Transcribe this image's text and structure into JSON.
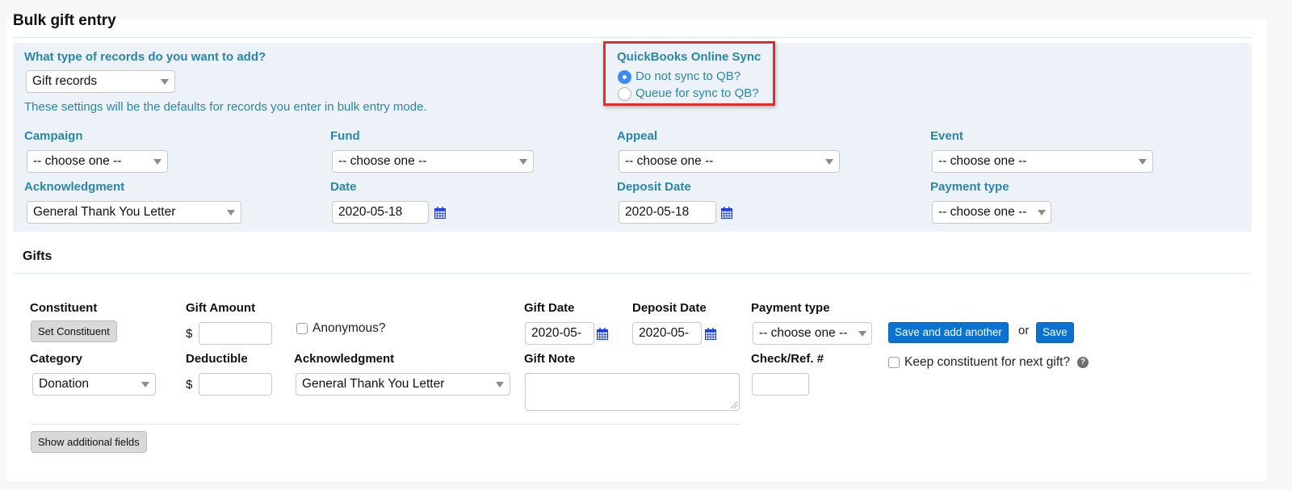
{
  "page": {
    "title": "Bulk gift entry"
  },
  "defaults": {
    "record_type": {
      "label": "What type of records do you want to add?",
      "value": "Gift records"
    },
    "help_text": "These settings will be the defaults for records you enter in bulk entry mode.",
    "quickbooks": {
      "label": "QuickBooks Online Sync",
      "options": [
        {
          "label": "Do not sync to QB?",
          "checked": true
        },
        {
          "label": "Queue for sync to QB?",
          "checked": false
        }
      ]
    },
    "campaign": {
      "label": "Campaign",
      "value": "-- choose one --"
    },
    "fund": {
      "label": "Fund",
      "value": "-- choose one --"
    },
    "appeal": {
      "label": "Appeal",
      "value": "-- choose one --"
    },
    "event": {
      "label": "Event",
      "value": "-- choose one --"
    },
    "acknowledgment": {
      "label": "Acknowledgment",
      "value": "General Thank You Letter"
    },
    "date": {
      "label": "Date",
      "value": "2020-05-18"
    },
    "deposit_date": {
      "label": "Deposit Date",
      "value": "2020-05-18"
    },
    "payment_type": {
      "label": "Payment type",
      "value": "-- choose one --"
    }
  },
  "gifts": {
    "title": "Gifts",
    "constituent": {
      "label": "Constituent",
      "button": "Set Constituent"
    },
    "gift_amount": {
      "label": "Gift Amount",
      "currency": "$",
      "value": ""
    },
    "anonymous": {
      "label": "Anonymous?",
      "checked": false
    },
    "gift_date": {
      "label": "Gift Date",
      "value": "2020-05-"
    },
    "deposit_date": {
      "label": "Deposit Date",
      "value": "2020-05-"
    },
    "payment_type": {
      "label": "Payment type",
      "value": "-- choose one --"
    },
    "save_and_add_another": "Save and add another",
    "or_text": "or",
    "save": "Save",
    "category": {
      "label": "Category",
      "value": "Donation"
    },
    "deductible": {
      "label": "Deductible",
      "currency": "$",
      "value": ""
    },
    "acknowledgment": {
      "label": "Acknowledgment",
      "value": "General Thank You Letter"
    },
    "gift_note": {
      "label": "Gift Note",
      "value": ""
    },
    "check_ref": {
      "label": "Check/Ref. #",
      "value": ""
    },
    "keep_constituent": {
      "label": "Keep constituent for next gift?",
      "checked": false
    },
    "help_icon": "?",
    "show_additional_fields": "Show additional fields"
  },
  "colors": {
    "accent_label": "#2a86a8",
    "primary_button": "#0a72d1",
    "highlight_box": "#e52b2b",
    "panel_background": "#edf2f8"
  }
}
